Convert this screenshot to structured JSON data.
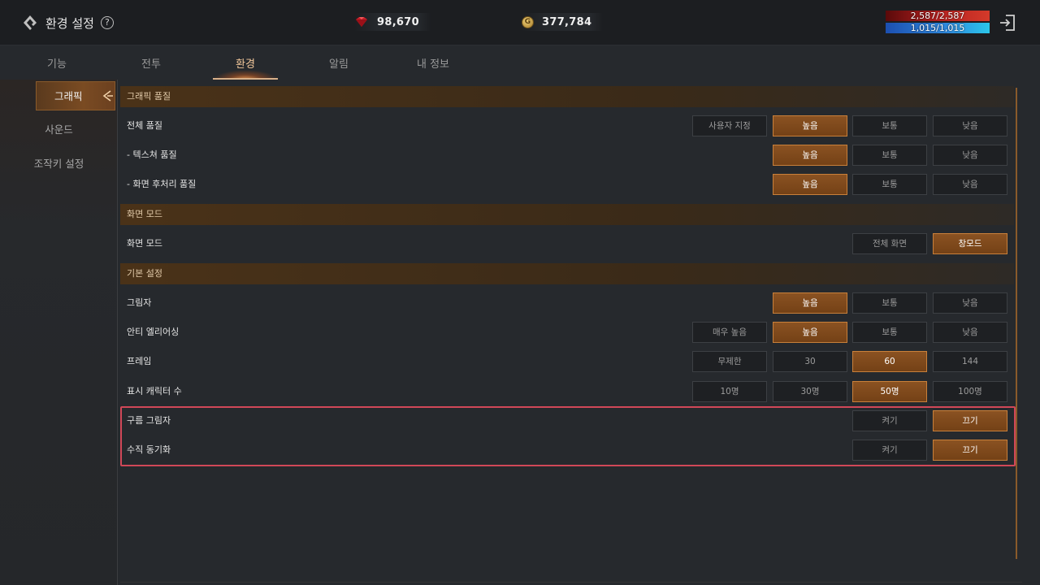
{
  "header": {
    "title": "환경 설정",
    "help_icon": "?",
    "gems": "98,670",
    "gold": "377,784",
    "coin_letter": "G",
    "hp": "2,587/2,587",
    "mp": "1,015/1,015",
    "colors": {
      "hp": "#c02a24",
      "mp": "#2a9ad8",
      "accent": "#c9803a"
    }
  },
  "tabs": [
    "기능",
    "전투",
    "환경",
    "알림",
    "내 정보"
  ],
  "active_tab": "환경",
  "sidebar": [
    "그래픽",
    "사운드",
    "조작키 설정"
  ],
  "sections": {
    "graphics_quality": "그래픽 품질",
    "screen_mode": "화면 모드",
    "basic": "기본 설정"
  },
  "rows": {
    "overall_quality": {
      "label": "전체 품질",
      "options": [
        "사용자 지정",
        "높음",
        "보통",
        "낮음"
      ],
      "selected": "높음"
    },
    "texture_quality": {
      "label": "- 텍스쳐 품질",
      "options": [
        "높음",
        "보통",
        "낮음"
      ],
      "selected": "높음"
    },
    "post_quality": {
      "label": "- 화면 후처리 품질",
      "options": [
        "높음",
        "보통",
        "낮음"
      ],
      "selected": "높음"
    },
    "screen_mode": {
      "label": "화면 모드",
      "options": [
        "전체 화면",
        "창모드"
      ],
      "selected": "창모드"
    },
    "shadow": {
      "label": "그림자",
      "options": [
        "높음",
        "보통",
        "낮음"
      ],
      "selected": "높음"
    },
    "antialias": {
      "label": "안티 엘리어싱",
      "options": [
        "매우 높음",
        "높음",
        "보통",
        "낮음"
      ],
      "selected": "높음"
    },
    "frame": {
      "label": "프레임",
      "options": [
        "무제한",
        "30",
        "60",
        "144"
      ],
      "selected": "60"
    },
    "characters": {
      "label": "표시 캐릭터 수",
      "options": [
        "10명",
        "30명",
        "50명",
        "100명"
      ],
      "selected": "50명"
    },
    "cloud_shadow": {
      "label": "구름 그림자",
      "options": [
        "켜기",
        "끄기"
      ],
      "selected": "끄기"
    },
    "vsync": {
      "label": "수직 동기화",
      "options": [
        "켜기",
        "끄기"
      ],
      "selected": "끄기"
    }
  }
}
